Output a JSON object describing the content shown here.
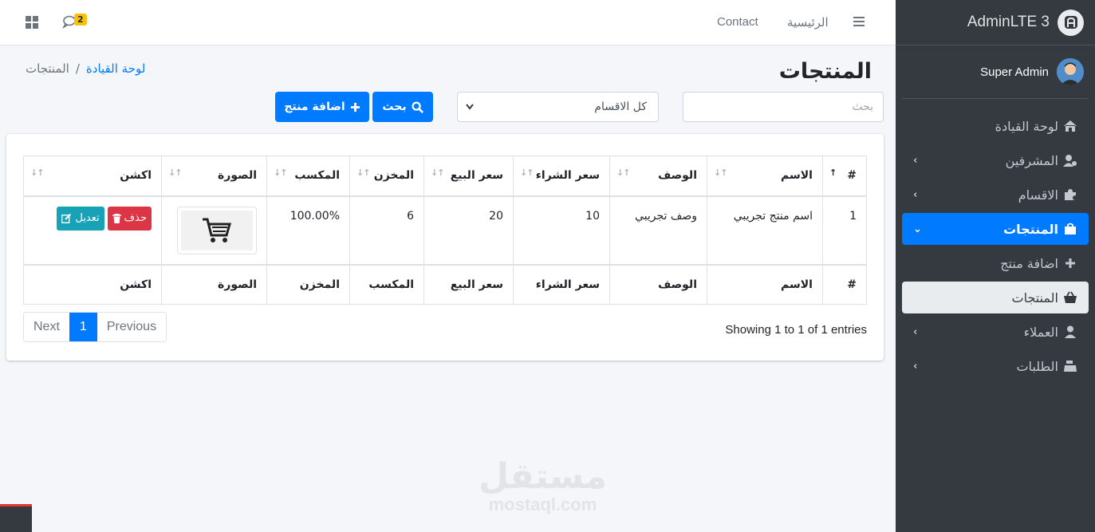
{
  "navbar": {
    "notifications_count": "2",
    "contact_label": "Contact",
    "home_label": "الرئيسية"
  },
  "sidebar": {
    "brand": "AdminLTE 3",
    "user_name": "Super Admin",
    "items": [
      {
        "label": "لوحة القيادة",
        "icon": "home-icon"
      },
      {
        "label": "المشرفين",
        "icon": "users-cog-icon",
        "chevron": "‹"
      },
      {
        "label": "الاقسام",
        "icon": "puzzle-icon",
        "chevron": "‹"
      },
      {
        "label": "المنتجات",
        "icon": "shopping-bag-icon",
        "chevron": "⌄"
      },
      {
        "label": "اضافة منتج",
        "icon": "plus-icon"
      },
      {
        "label": "المنتجات",
        "icon": "basket-icon"
      },
      {
        "label": "العملاء",
        "icon": "user-tie-icon",
        "chevron": "‹"
      },
      {
        "label": "الطلبات",
        "icon": "cash-register-icon",
        "chevron": "‹"
      }
    ]
  },
  "header": {
    "title": "المنتجات",
    "breadcrumb": {
      "dashboard": "لوحة القيادة",
      "separator": "/",
      "current": "المنتجات"
    }
  },
  "filters": {
    "search_placeholder": "بحث",
    "category_selected": "كل الاقسام",
    "search_button": "بحث",
    "add_button": "اضافة منتج"
  },
  "table": {
    "headers": [
      "#",
      "الاسم",
      "الوصف",
      "سعر الشراء",
      "سعر البيع",
      "المخزن",
      "المكسب",
      "الصورة",
      "اكشن"
    ],
    "footer": [
      "#",
      "الاسم",
      "الوصف",
      "سعر الشراء",
      "سعر البيع",
      "المكسب",
      "المخزن",
      "الصورة",
      "اكشن"
    ],
    "rows": [
      {
        "id": "1",
        "name": "اسم منتج تجريبي",
        "description": "وصف تجريبي",
        "purchase_price": "10",
        "sale_price": "20",
        "stock": "6",
        "profit": "100.00%",
        "edit_label": "تعديل",
        "delete_label": "حذف"
      }
    ]
  },
  "pagination": {
    "info": "Showing 1 to 1 of 1 entries",
    "next": "Next",
    "current": "1",
    "previous": "Previous"
  },
  "watermark": {
    "arabic": "مستقل",
    "english": "mostaql.com"
  },
  "colors": {
    "primary": "#007bff",
    "sidebar": "#343a40",
    "info": "#17a2b8",
    "danger": "#dc3545",
    "badge": "#ffc107"
  }
}
